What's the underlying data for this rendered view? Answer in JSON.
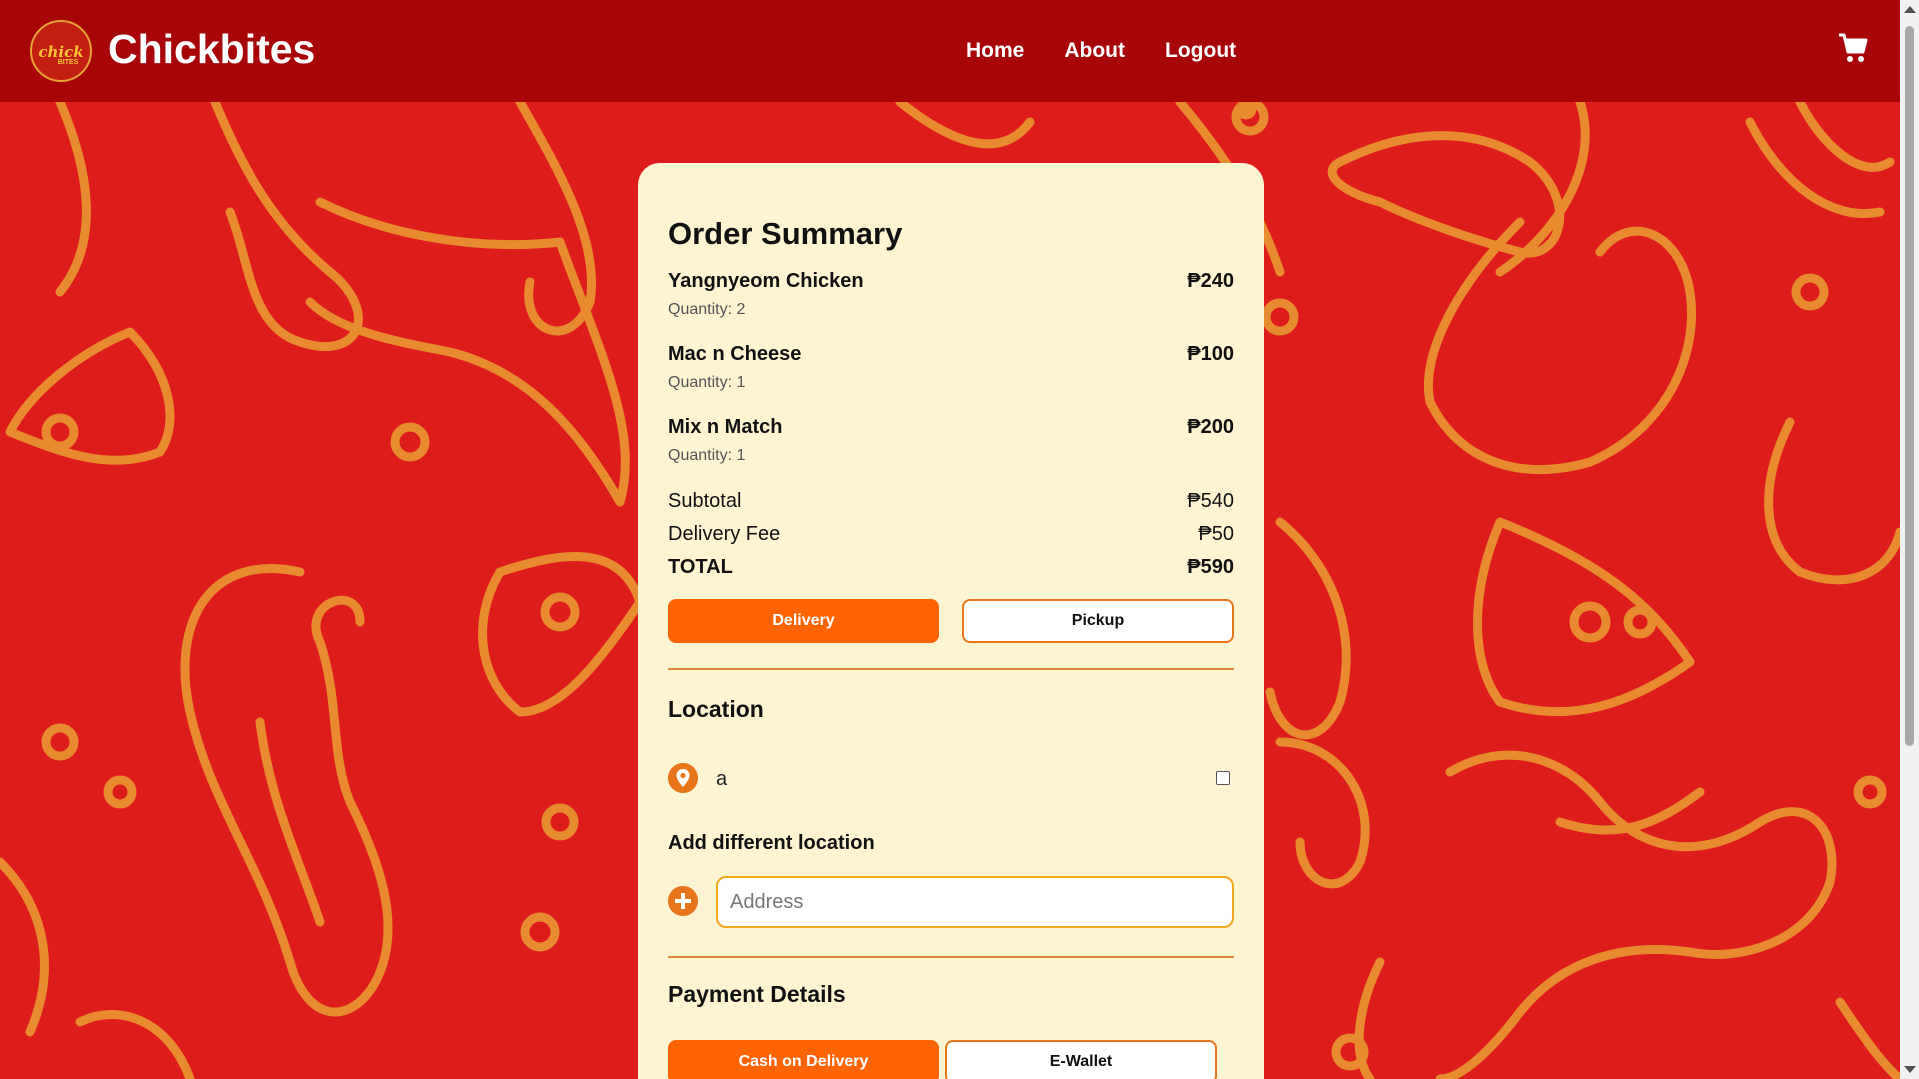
{
  "header": {
    "logo_text_line1": "chick",
    "logo_text_line2": "BITES",
    "brand": "Chickbites",
    "nav": [
      {
        "label": "Home"
      },
      {
        "label": "About"
      },
      {
        "label": "Logout"
      }
    ],
    "cart_icon": "shopping-cart-icon"
  },
  "order": {
    "title": "Order Summary",
    "items": [
      {
        "name": "Yangnyeom Chicken",
        "price": "₱240",
        "quantity": "Quantity: 2"
      },
      {
        "name": "Mac n Cheese",
        "price": "₱100",
        "quantity": "Quantity: 1"
      },
      {
        "name": "Mix n Match",
        "price": "₱200",
        "quantity": "Quantity: 1"
      }
    ],
    "subtotal_label": "Subtotal",
    "subtotal_value": "₱540",
    "delivery_fee_label": "Delivery Fee",
    "delivery_fee_value": "₱50",
    "total_label": "TOTAL",
    "total_value": "₱590"
  },
  "fulfillment": {
    "delivery_label": "Delivery",
    "pickup_label": "Pickup",
    "selected": "Delivery"
  },
  "location": {
    "title": "Location",
    "saved_address": "a",
    "saved_checked": false,
    "pin_icon": "location-pin-icon",
    "add_title": "Add different location",
    "add_icon": "plus-circle-icon",
    "address_placeholder": "Address",
    "address_value": ""
  },
  "payment": {
    "title": "Payment Details",
    "cod_label": "Cash on Delivery",
    "ewallet_label": "E-Wallet",
    "selected": "Cash on Delivery"
  },
  "colors": {
    "header_bg": "#a70507",
    "page_bg": "#de1c1c",
    "doodle": "#e88a2e",
    "card_bg": "#fdf4d2",
    "accent": "#ff6404"
  }
}
